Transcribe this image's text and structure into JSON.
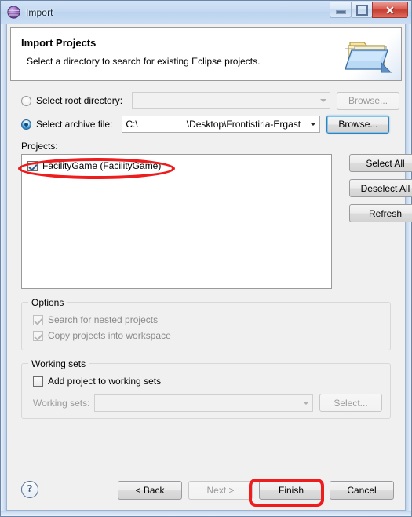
{
  "window": {
    "title": "Import",
    "icon": "eclipse-sphere-icon",
    "controls": {
      "minimize": "minimize-icon",
      "maximize": "maximize-icon",
      "close": "✕"
    }
  },
  "banner": {
    "title": "Import Projects",
    "subtitle": "Select a directory to search for existing Eclipse projects.",
    "icon": "open-folder-icon"
  },
  "source": {
    "root_directory": {
      "label": "Select root directory:",
      "selected": false,
      "value": "",
      "placeholder": "",
      "browse_label": "Browse...",
      "enabled": false
    },
    "archive_file": {
      "label": "Select archive file:",
      "selected": true,
      "value_prefix": "C:\\",
      "value_suffix": "\\Desktop\\Frontistiria-Ergast",
      "browse_label": "Browse...",
      "enabled": true
    }
  },
  "projects": {
    "label": "Projects:",
    "items": [
      {
        "label": "FacilityGame (FacilityGame)",
        "checked": true
      }
    ],
    "buttons": [
      {
        "label": "Select All"
      },
      {
        "label": "Deselect All"
      },
      {
        "label": "Refresh"
      }
    ]
  },
  "options": {
    "title": "Options",
    "items": [
      {
        "label": "Search for nested projects",
        "checked": true,
        "enabled": false
      },
      {
        "label": "Copy projects into workspace",
        "checked": true,
        "enabled": false
      }
    ]
  },
  "working_sets": {
    "title": "Working sets",
    "add_checkbox": {
      "label": "Add project to working sets",
      "checked": false
    },
    "field_label": "Working sets:",
    "field_value": "",
    "select_label": "Select..."
  },
  "footer": {
    "help": "?",
    "buttons": [
      {
        "label": "< Back",
        "enabled": true
      },
      {
        "label": "Next >",
        "enabled": false
      },
      {
        "label": "Finish",
        "enabled": true,
        "highlighted": true
      },
      {
        "label": "Cancel",
        "enabled": true
      }
    ]
  },
  "annotations": {
    "color": "#ee1c1c",
    "shapes": [
      {
        "type": "ellipse",
        "target": "project-list-item"
      },
      {
        "type": "rounded-rect",
        "target": "finish-button"
      }
    ]
  }
}
